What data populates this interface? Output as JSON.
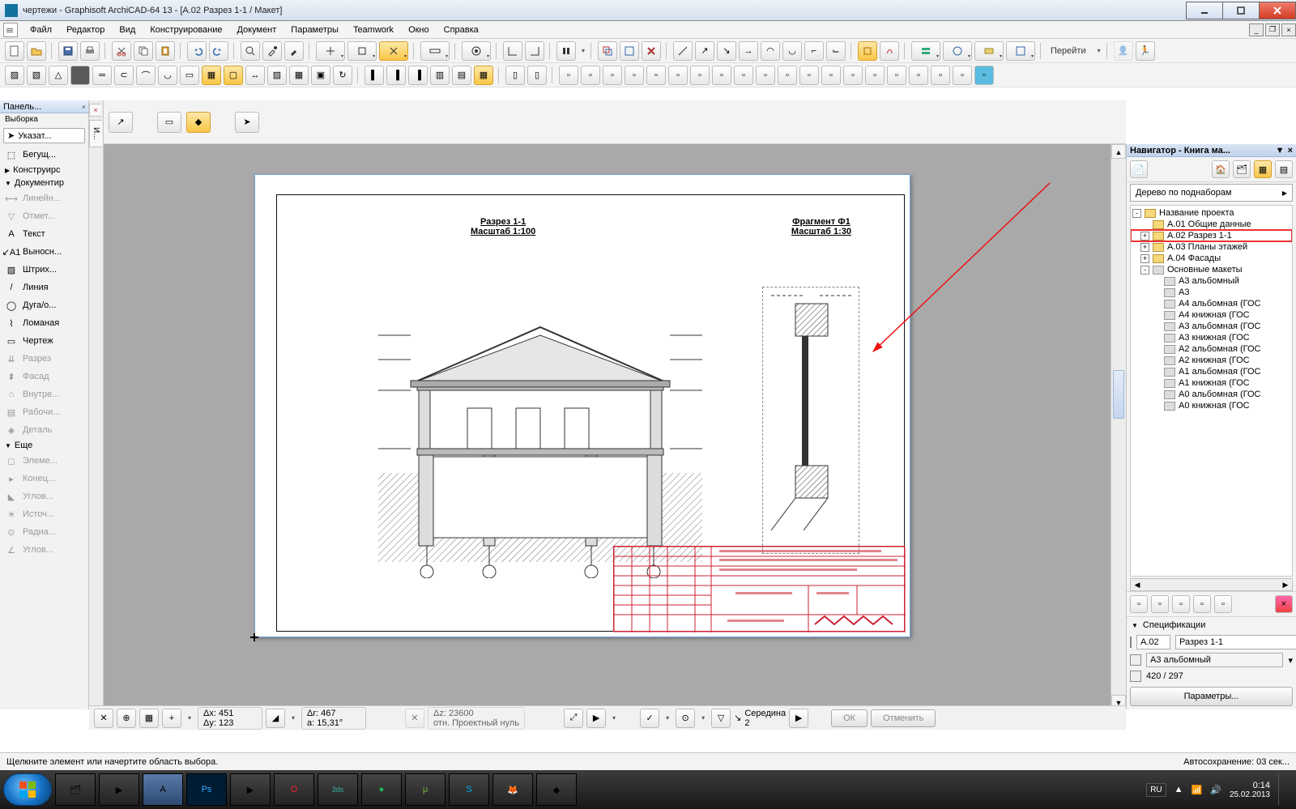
{
  "window": {
    "title": "чертежи - Graphisoft ArchiCAD-64 13 - [A.02 Разрез 1-1 / Макет]"
  },
  "menu": {
    "items": [
      "Файл",
      "Редактор",
      "Вид",
      "Конструирование",
      "Документ",
      "Параметры",
      "Teamwork",
      "Окно",
      "Справка"
    ]
  },
  "goto_label": "Перейти",
  "left_panel": {
    "title": "Панель...",
    "sub": "Выборка",
    "pointer": "Указат...",
    "sections": [
      {
        "kind": "item",
        "label": "Бегущ...",
        "icon": "marquee"
      },
      {
        "kind": "section",
        "label": "Конструирс",
        "tri": "▶"
      },
      {
        "kind": "section",
        "label": "Документир",
        "tri": "▼"
      },
      {
        "kind": "item",
        "label": "Линейн...",
        "icon": "dim",
        "disabled": true
      },
      {
        "kind": "item",
        "label": "Отмет...",
        "icon": "level",
        "disabled": true
      },
      {
        "kind": "item",
        "label": "Текст",
        "icon": "text"
      },
      {
        "kind": "item",
        "label": "Выносн...",
        "icon": "leader"
      },
      {
        "kind": "item",
        "label": "Штрих...",
        "icon": "hatch"
      },
      {
        "kind": "item",
        "label": "Линия",
        "icon": "line"
      },
      {
        "kind": "item",
        "label": "Дуга/о...",
        "icon": "arc"
      },
      {
        "kind": "item",
        "label": "Ломаная",
        "icon": "poly"
      },
      {
        "kind": "item",
        "label": "Чертеж",
        "icon": "drawing"
      },
      {
        "kind": "item",
        "label": "Разрез",
        "icon": "section",
        "disabled": true
      },
      {
        "kind": "item",
        "label": "Фасад",
        "icon": "elev",
        "disabled": true
      },
      {
        "kind": "item",
        "label": "Внутре...",
        "icon": "interior",
        "disabled": true
      },
      {
        "kind": "item",
        "label": "Рабочи...",
        "icon": "worksheet",
        "disabled": true
      },
      {
        "kind": "item",
        "label": "Деталь",
        "icon": "detail",
        "disabled": true
      },
      {
        "kind": "section",
        "label": "Еще",
        "tri": "▼"
      },
      {
        "kind": "item",
        "label": "Элеме...",
        "icon": "elem",
        "disabled": true
      },
      {
        "kind": "item",
        "label": "Конец...",
        "icon": "end",
        "disabled": true
      },
      {
        "kind": "item",
        "label": "Углов...",
        "icon": "corner",
        "disabled": true
      },
      {
        "kind": "item",
        "label": "Источ...",
        "icon": "light",
        "disabled": true
      },
      {
        "kind": "item",
        "label": "Радиа...",
        "icon": "radial",
        "disabled": true
      },
      {
        "kind": "item",
        "label": "Углов...",
        "icon": "angle",
        "disabled": true
      }
    ]
  },
  "cursor_bar": {
    "vtab_label": "И..."
  },
  "drawing": {
    "section_title": "Разрез 1-1",
    "section_scale": "Масштаб 1:100",
    "fragment_title": "Фрагмент Ф1",
    "fragment_scale": "Масштаб 1:30"
  },
  "navigator": {
    "title": "Навигатор - Книга ма...",
    "combo": "Дерево по поднаборам",
    "tree": [
      {
        "lvl": 0,
        "exp": "-",
        "label": "Название проекта",
        "icon": "proj"
      },
      {
        "lvl": 1,
        "exp": "",
        "label": "A.01 Общие данные",
        "icon": "page"
      },
      {
        "lvl": 1,
        "exp": "+",
        "label": "A.02 Разрез 1-1",
        "icon": "page",
        "selected": true
      },
      {
        "lvl": 1,
        "exp": "+",
        "label": "A.03 Планы этажей",
        "icon": "page"
      },
      {
        "lvl": 1,
        "exp": "+",
        "label": "A.04 Фасады",
        "icon": "page"
      },
      {
        "lvl": 1,
        "exp": "-",
        "label": "Основные макеты",
        "icon": "folder"
      },
      {
        "lvl": 2,
        "exp": "",
        "label": "A3 альбомный",
        "icon": "layout"
      },
      {
        "lvl": 2,
        "exp": "",
        "label": "A3",
        "icon": "layout"
      },
      {
        "lvl": 2,
        "exp": "",
        "label": "A4 альбомная (ГОС",
        "icon": "layout"
      },
      {
        "lvl": 2,
        "exp": "",
        "label": "A4 книжная (ГОС",
        "icon": "layout"
      },
      {
        "lvl": 2,
        "exp": "",
        "label": "A3 альбомная (ГОС",
        "icon": "layout"
      },
      {
        "lvl": 2,
        "exp": "",
        "label": "A3 книжная (ГОС",
        "icon": "layout"
      },
      {
        "lvl": 2,
        "exp": "",
        "label": "A2 альбомная (ГОС",
        "icon": "layout"
      },
      {
        "lvl": 2,
        "exp": "",
        "label": "A2 книжная (ГОС",
        "icon": "layout"
      },
      {
        "lvl": 2,
        "exp": "",
        "label": "A1 альбомная (ГОС",
        "icon": "layout"
      },
      {
        "lvl": 2,
        "exp": "",
        "label": "A1 книжная (ГОС",
        "icon": "layout"
      },
      {
        "lvl": 2,
        "exp": "",
        "label": "A0 альбомная (ГОС",
        "icon": "layout"
      },
      {
        "lvl": 2,
        "exp": "",
        "label": "A0 книжная (ГОС",
        "icon": "layout"
      }
    ],
    "spec_label": "Спецификации",
    "code": "A.02",
    "name": "Разрез 1-1",
    "master": "A3 альбомный",
    "size": "420 / 297",
    "params_btn": "Параметры..."
  },
  "measure": {
    "dx_label": "Δx:",
    "dx": "451",
    "dy_label": "Δy:",
    "dy": "123",
    "dr_label": "Δr:",
    "dr": "467",
    "da_label": "a:",
    "da": "15,31°",
    "dz_label": "Δz:",
    "dz": "23600",
    "ref_label": "отн.",
    "ref": "Проектный нуль",
    "mid_label": "Середина",
    "mid_val": "2",
    "ok": "ОК",
    "cancel": "Отменить"
  },
  "status": {
    "hint": "Щелкните элемент или начертите область выбора.",
    "autosave": "Автосохранение: 03 сек..."
  },
  "taskbar": {
    "lang": "RU",
    "time": "0:14",
    "date": "25.02.2013"
  }
}
